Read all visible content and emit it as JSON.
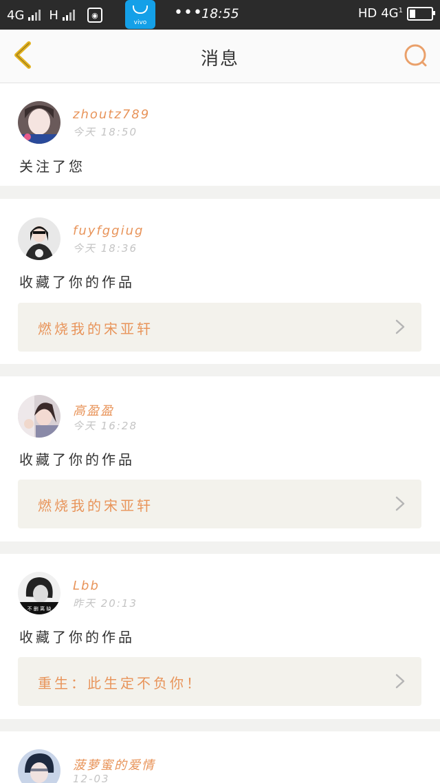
{
  "status_bar": {
    "net1": "4G",
    "net2": "H",
    "time": "18:55",
    "vivo_label": "vivo",
    "dots": "•••",
    "hd": "HD",
    "net_right": "4G",
    "net_right_sub": "1"
  },
  "nav": {
    "title": "消息"
  },
  "colors": {
    "accent": "#e8945a",
    "back_icon": "#e3b21f"
  },
  "messages": [
    {
      "username": "zhoutz789",
      "time": "今天 18:50",
      "action": "关注了您",
      "work": ""
    },
    {
      "username": "fuyfggiug",
      "time": "今天 18:36",
      "action": "收藏了你的作品",
      "work": "燃烧我的宋亚轩"
    },
    {
      "username": "高盈盈",
      "time": "今天 16:28",
      "action": "收藏了你的作品",
      "work": "燃烧我的宋亚轩"
    },
    {
      "username": "Lbb",
      "time": "昨天 20:13",
      "action": "收藏了你的作品",
      "work": "重生：此生定不负你！",
      "avatar_caption": "不 删 离 缺"
    },
    {
      "username": "菠萝蜜的爱情",
      "time": "12-03",
      "action": "",
      "work": ""
    }
  ]
}
